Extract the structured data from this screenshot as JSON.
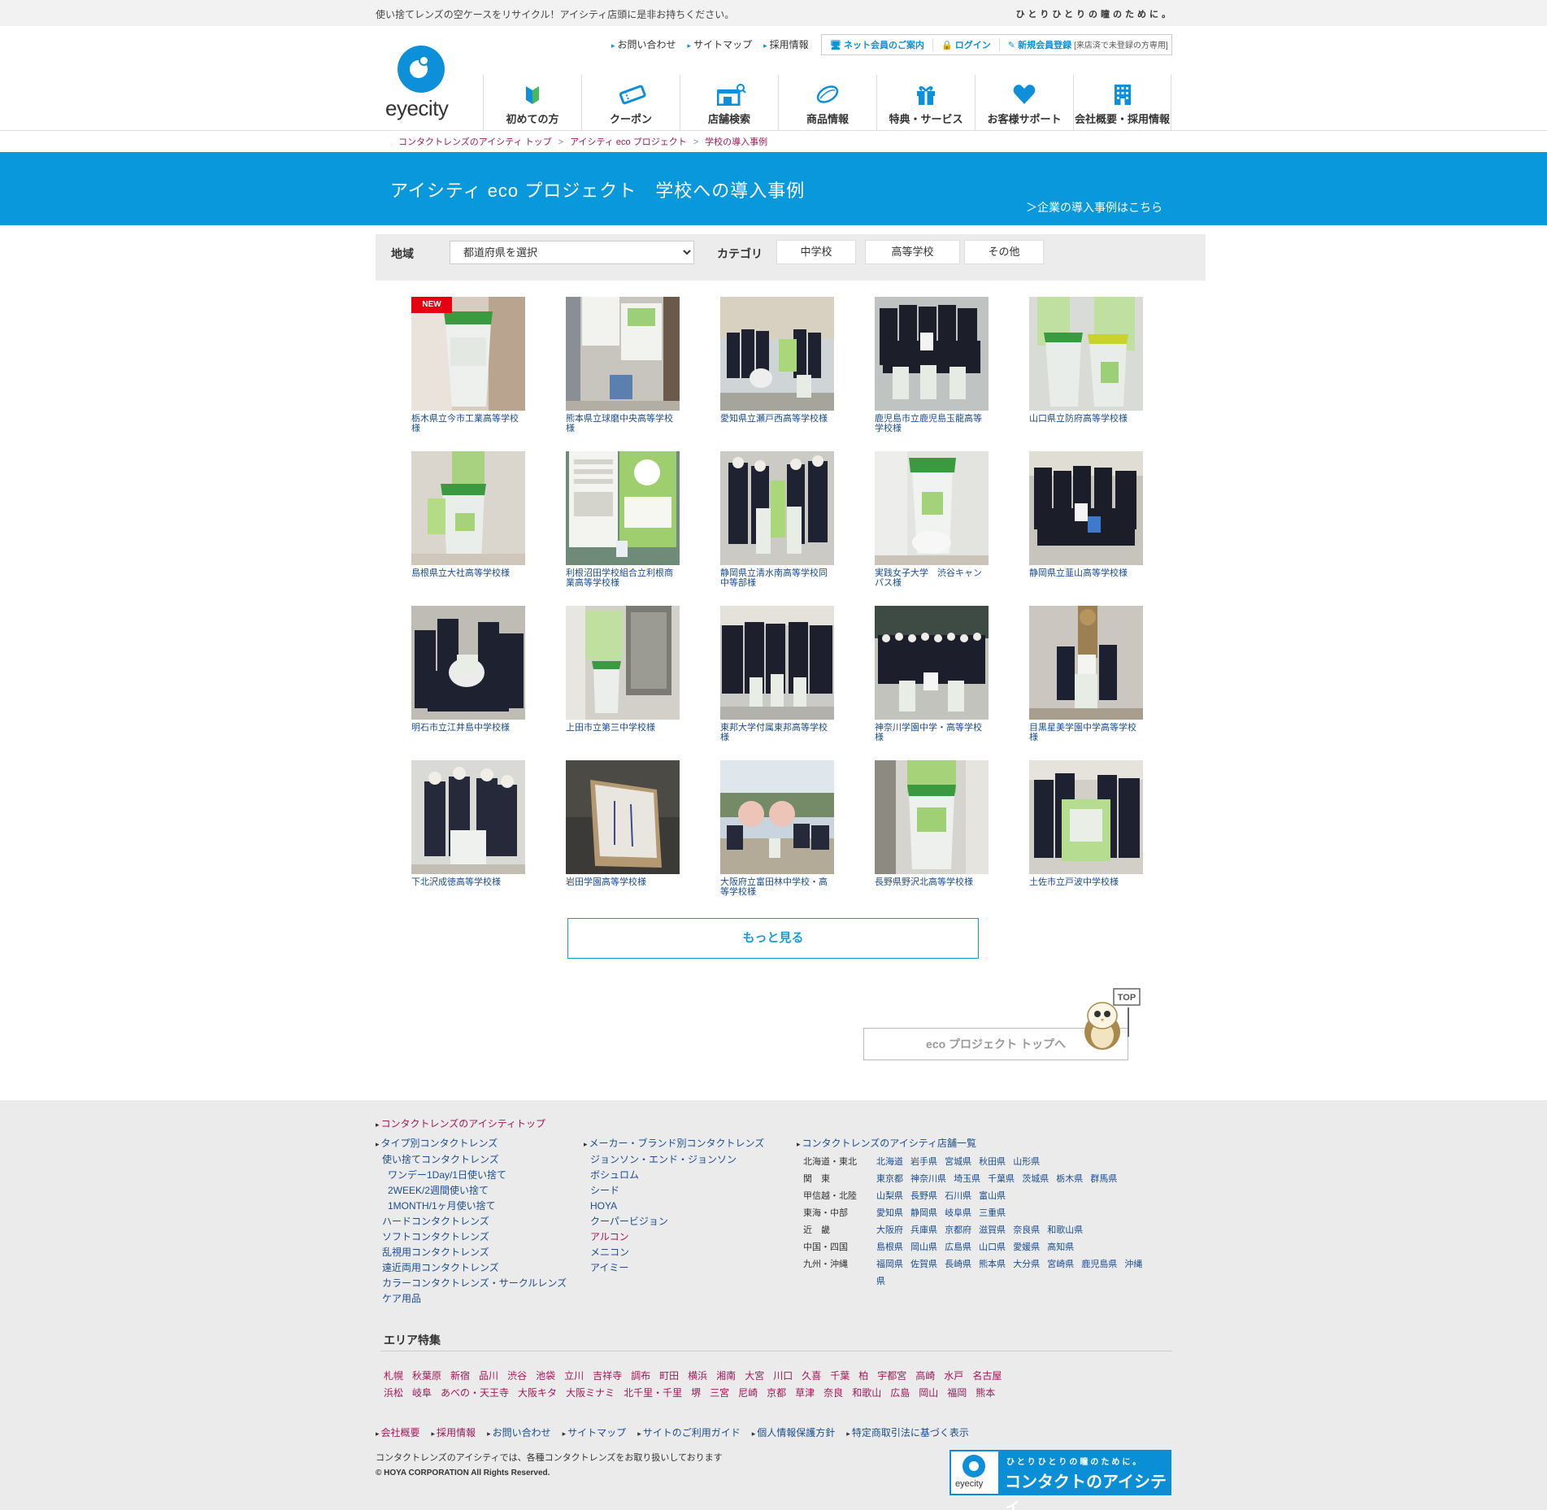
{
  "topstrip": {
    "message": "使い捨てレンズの空ケースをリサイクル！アイシティ店頭に是非お持ちください。",
    "tagline": "ひとりひとりの瞳のために。"
  },
  "logo": {
    "word": "eyecity"
  },
  "utility_nav": [
    "お問い合わせ",
    "サイトマップ",
    "採用情報"
  ],
  "member": {
    "guide": "ネット会員のご案内",
    "login": "ログイン",
    "register": "新規会員登録",
    "register_note": "[来店済で未登録の方専用]"
  },
  "global_nav": [
    {
      "label": "初めての方",
      "icon": "beginner-mark-icon"
    },
    {
      "label": "クーポン",
      "icon": "coupon-ticket-icon"
    },
    {
      "label": "店舗検索",
      "icon": "store-search-icon"
    },
    {
      "label": "商品情報",
      "icon": "contact-lens-icon"
    },
    {
      "label": "特典・サービス",
      "icon": "gift-icon"
    },
    {
      "label": "お客様サポート",
      "icon": "heart-icon"
    },
    {
      "label": "会社概要・採用情報",
      "icon": "building-icon"
    }
  ],
  "breadcrumb": [
    "コンタクトレンズのアイシティ トップ",
    "アイシティ eco プロジェクト",
    "学校の導入事例"
  ],
  "banner": {
    "title": "アイシティ eco プロジェクト　学校への導入事例",
    "corp_link": "＞企業の導入事例はこちら"
  },
  "filter": {
    "region_label": "地域",
    "region_select": "都道府県を選択",
    "category_label": "カテゴリ",
    "categories": [
      "中学校",
      "高等学校",
      "その他"
    ]
  },
  "cases": [
    {
      "caption": "栃木県立今市工業高等学校様",
      "badge": "NEW"
    },
    {
      "caption": "熊本県立球磨中央高等学校様"
    },
    {
      "caption": "愛知県立瀬戸西高等学校様"
    },
    {
      "caption": "鹿児島市立鹿児島玉龍高等学校様"
    },
    {
      "caption": "山口県立防府高等学校様"
    },
    {
      "caption": "島根県立大社高等学校様"
    },
    {
      "caption": "利根沼田学校組合立利根商業高等学校様"
    },
    {
      "caption": "静岡県立清水南高等学校同中等部様"
    },
    {
      "caption": "実践女子大学　渋谷キャンパス様"
    },
    {
      "caption": "静岡県立韮山高等学校様"
    },
    {
      "caption": "明石市立江井島中学校様"
    },
    {
      "caption": "上田市立第三中学校様"
    },
    {
      "caption": "東邦大学付属東邦高等学校様"
    },
    {
      "caption": "神奈川学園中学・高等学校様"
    },
    {
      "caption": "目黒星美学園中学高等学校様"
    },
    {
      "caption": "下北沢成徳高等学校様"
    },
    {
      "caption": "岩田学園高等学校様"
    },
    {
      "caption": "大阪府立富田林中学校・高等学校様"
    },
    {
      "caption": "長野県野沢北高等学校様"
    },
    {
      "caption": "土佐市立戸波中学校様"
    }
  ],
  "more_button": "もっと見る",
  "eco_top_button": "eco プロジェクト トップへ",
  "mascot_sign": "TOP",
  "footer": {
    "top_link": "コンタクトレンズのアイシティトップ",
    "type_head": "タイプ別コンタクトレンズ",
    "type_links": [
      {
        "t": "使い捨てコンタクトレンズ",
        "lvl": 1
      },
      {
        "t": "ワンデー1Day/1日使い捨て",
        "lvl": 2
      },
      {
        "t": "2WEEK/2週間使い捨て",
        "lvl": 2
      },
      {
        "t": "1MONTH/1ヶ月使い捨て",
        "lvl": 2
      },
      {
        "t": "ハードコンタクトレンズ",
        "lvl": 1
      },
      {
        "t": "ソフトコンタクトレンズ",
        "lvl": 1
      },
      {
        "t": "乱視用コンタクトレンズ",
        "lvl": 1
      },
      {
        "t": "遠近両用コンタクトレンズ",
        "lvl": 1
      },
      {
        "t": "カラーコンタクトレンズ・サークルレンズ",
        "lvl": 1
      },
      {
        "t": "ケア用品",
        "lvl": 1
      }
    ],
    "maker_head": "メーカー・ブランド別コンタクトレンズ",
    "maker_links": [
      "ジョンソン・エンド・ジョンソン",
      "ボシュロム",
      "シード",
      "HOYA",
      "クーパービジョン",
      "アルコン",
      "メニコン",
      "アイミー"
    ],
    "store_head": "コンタクトレンズのアイシティ店舗一覧",
    "stores": [
      {
        "region": "北海道・東北",
        "prefs": "北海道 岩手県 宮城県 秋田県 山形県"
      },
      {
        "region": "関　東",
        "prefs": "東京都 神奈川県 埼玉県 千葉県 茨城県 栃木県 群馬県"
      },
      {
        "region": "甲信越・北陸",
        "prefs": "山梨県 長野県 石川県 富山県"
      },
      {
        "region": "東海・中部",
        "prefs": "愛知県 静岡県 岐阜県 三重県"
      },
      {
        "region": "近　畿",
        "prefs": "大阪府 兵庫県 京都府 滋賀県 奈良県 和歌山県"
      },
      {
        "region": "中国・四国",
        "prefs": "島根県 岡山県 広島県 山口県 愛媛県 高知県"
      },
      {
        "region": "九州・沖縄",
        "prefs": "福岡県 佐賀県 長崎県 熊本県 大分県 宮崎県 鹿児島県 沖縄県"
      }
    ],
    "area_title": "エリア特集",
    "areas_row1": [
      "札幌",
      "秋葉原",
      "新宿",
      "品川",
      "渋谷",
      "池袋",
      "立川",
      "吉祥寺",
      "調布",
      "町田",
      "横浜",
      "湘南",
      "大宮",
      "川口",
      "久喜",
      "千葉",
      "柏",
      "宇都宮",
      "高崎",
      "水戸",
      "名古屋"
    ],
    "areas_row2": [
      "浜松",
      "岐阜",
      "あべの・天王寺",
      "大阪キタ",
      "大阪ミナミ",
      "北千里・千里",
      "堺",
      "三宮",
      "尼崎",
      "京都",
      "草津",
      "奈良",
      "和歌山",
      "広島",
      "岡山",
      "福岡",
      "熊本"
    ],
    "bottom_links": [
      "会社概要",
      "採用情報",
      "お問い合わせ",
      "サイトマップ",
      "サイトのご利用ガイド",
      "個人情報保護方針",
      "特定商取引法に基づく表示"
    ],
    "note": "コンタクトレンズのアイシティでは、各種コンタクトレンズをお取り扱いしております",
    "copyright": "© HOYA CORPORATION All Rights Reserved.",
    "banner_tagline": "ひとりひとりの瞳のために。",
    "banner_title": "コンタクトのアイシティ",
    "banner_logo": "eyecity"
  },
  "colors": {
    "brand_blue": "#0a98dd",
    "link_red": "#a0185a",
    "link_blue": "#1b4d8f",
    "new_red": "#e60012"
  }
}
